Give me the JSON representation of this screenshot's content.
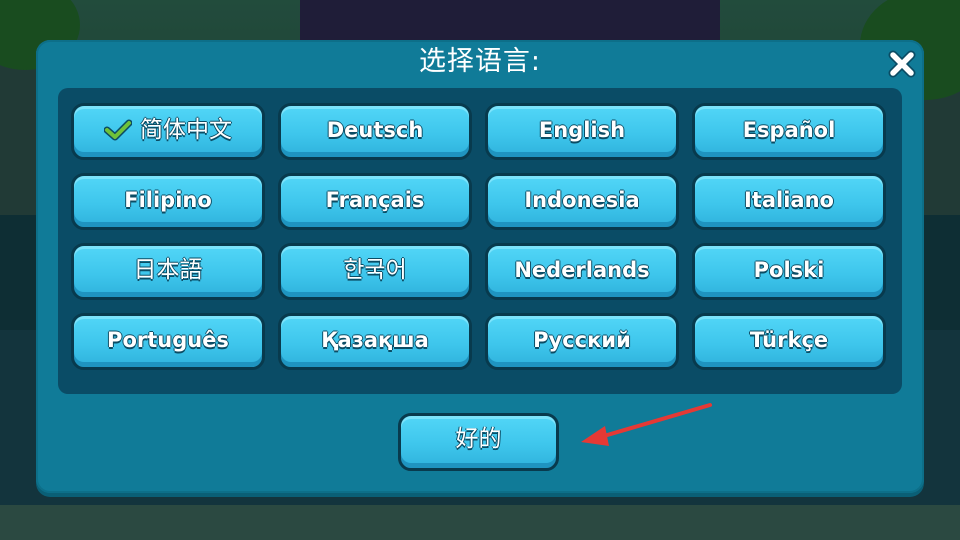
{
  "dialog": {
    "title": "选择语言:",
    "close_icon": "close-x-icon"
  },
  "languages": [
    {
      "label": "简体中文",
      "selected": true
    },
    {
      "label": "Deutsch",
      "selected": false
    },
    {
      "label": "English",
      "selected": false
    },
    {
      "label": "Español",
      "selected": false
    },
    {
      "label": "Filipino",
      "selected": false
    },
    {
      "label": "Français",
      "selected": false
    },
    {
      "label": "Indonesia",
      "selected": false
    },
    {
      "label": "Italiano",
      "selected": false
    },
    {
      "label": "日本語",
      "selected": false
    },
    {
      "label": "한국어",
      "selected": false
    },
    {
      "label": "Nederlands",
      "selected": false
    },
    {
      "label": "Polski",
      "selected": false
    },
    {
      "label": "Português",
      "selected": false
    },
    {
      "label": "Қазақша",
      "selected": false
    },
    {
      "label": "Русский",
      "selected": false
    },
    {
      "label": "Türkçe",
      "selected": false
    }
  ],
  "ok_button": {
    "label": "好的"
  },
  "annotation": {
    "arrow_color": "#e53935"
  },
  "colors": {
    "dialog_bg": "#107b98",
    "panel_bg": "#0a4c66",
    "button_bg": "#3ec6ec",
    "check": "#6fc23a"
  }
}
